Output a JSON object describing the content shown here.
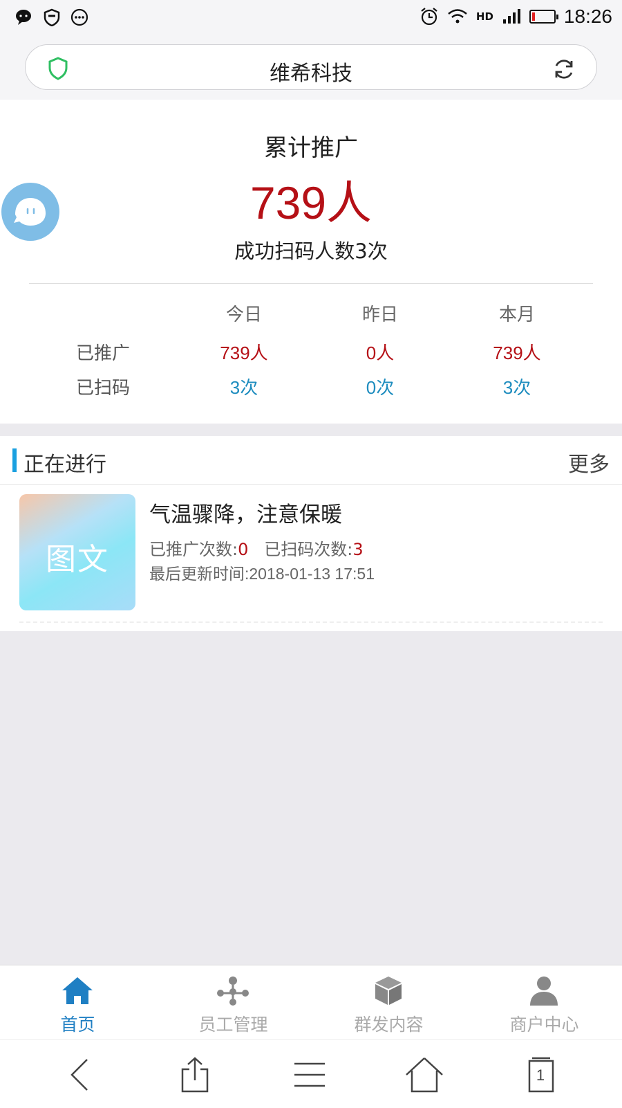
{
  "status_bar": {
    "time": "18:26",
    "network_label": "HD",
    "left_icons": [
      "wechat-icon",
      "shield-face-icon",
      "more-circle-icon"
    ],
    "right_icons": [
      "alarm-icon",
      "wifi-icon",
      "signal-icon",
      "battery-icon"
    ],
    "battery_color": "#e02020"
  },
  "address_bar": {
    "title": "维希科技",
    "security_icon": "shield-icon",
    "refresh_icon": "refresh-icon"
  },
  "summary": {
    "title": "累计推广",
    "count": "739人",
    "subtitle": "成功扫码人数3次",
    "accent_color": "#b51016"
  },
  "stats": {
    "headers": [
      "今日",
      "昨日",
      "本月"
    ],
    "rows": [
      {
        "label": "已推广",
        "values": [
          "739人",
          "0人",
          "739人"
        ]
      },
      {
        "label": "已扫码",
        "values": [
          "3次",
          "0次",
          "3次"
        ]
      }
    ]
  },
  "ongoing": {
    "title": "正在进行",
    "more": "更多",
    "items": [
      {
        "thumb_text": "图文",
        "title": "气温骤降，注意保暖",
        "promo_label": "已推广次数:",
        "promo_value": "0",
        "scan_label": "已扫码次数:",
        "scan_value": "3",
        "updated": "最后更新时间:2018-01-13 17:51"
      }
    ]
  },
  "tab_bar": {
    "active_color": "#1f7fc3",
    "tabs": [
      {
        "label": "首页",
        "icon": "home-icon",
        "active": true
      },
      {
        "label": "员工管理",
        "icon": "network-icon",
        "active": false
      },
      {
        "label": "群发内容",
        "icon": "box-icon",
        "active": false
      },
      {
        "label": "商户中心",
        "icon": "user-icon",
        "active": false
      }
    ]
  },
  "browser_bar": {
    "icons": [
      "back-icon",
      "share-icon",
      "menu-icon",
      "home-outline-icon",
      "tabs-icon"
    ],
    "tab_count": "1"
  }
}
